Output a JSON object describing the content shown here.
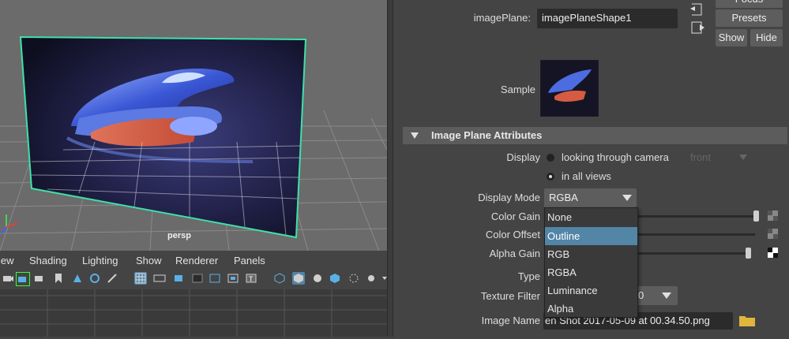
{
  "viewport": {
    "camera_label": "persp",
    "menu": [
      "iew",
      "Shading",
      "Lighting",
      "Show",
      "Renderer",
      "Panels"
    ]
  },
  "attribute_editor": {
    "image_plane_label": "imagePlane:",
    "image_plane_value": "imagePlaneShape1",
    "focus_button": "Focus",
    "presets_button": "Presets",
    "show_button": "Show",
    "hide_button": "Hide",
    "sample_label": "Sample",
    "section_title": "Image Plane Attributes",
    "display_label": "Display",
    "display_option_camera": "looking through camera",
    "display_option_camera_value": "front",
    "display_option_all": "in all views",
    "display_mode_label": "Display Mode",
    "display_mode_value": "RGBA",
    "color_gain_label": "Color Gain",
    "color_offset_label": "Color Offset",
    "alpha_gain_label": "Alpha Gain",
    "type_label": "Type",
    "texture_filter_label": "Texture Filter",
    "texture_filter_value": "0",
    "image_name_label": "Image Name",
    "image_name_value": "en Shot 2017-05-09 at 00.34.50.png",
    "color_gain_level": 1.0,
    "color_offset_level": 0.0,
    "alpha_gain_level": 0.98
  },
  "dropdown": {
    "options": [
      "None",
      "Outline",
      "RGB",
      "RGBA",
      "Luminance",
      "Alpha"
    ],
    "highlighted": "Outline"
  },
  "colors": {
    "selection": "#5285a6",
    "plane_outline": "#3fe0a8",
    "background": "#444444"
  }
}
